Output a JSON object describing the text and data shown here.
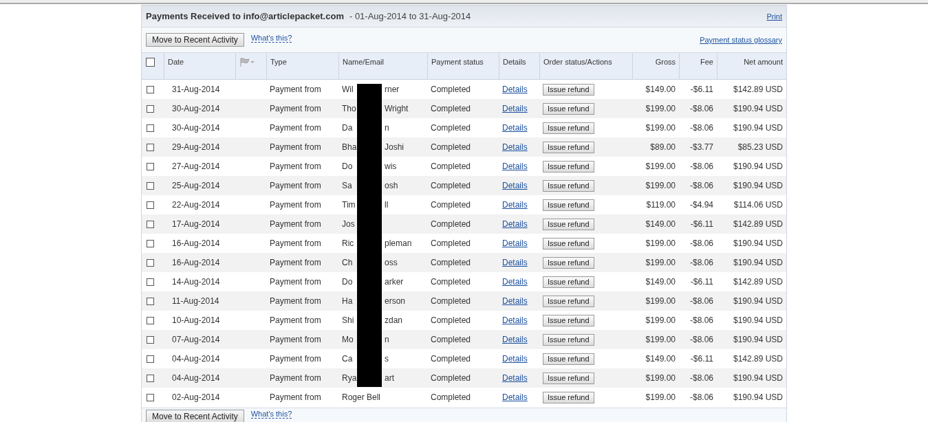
{
  "panel": {
    "title": "Payments Received to info@articlepacket.com",
    "date_range": "- 01-Aug-2014 to 31-Aug-2014",
    "print_link": "Print"
  },
  "toolbar": {
    "button": "Move to Recent Activity",
    "help_link": "What's this?",
    "glossary_link": "Payment status glossary"
  },
  "table": {
    "select_all": {
      "checked": false
    },
    "columns": [
      "Date",
      "Type",
      "Name/Email",
      "Payment status",
      "Details",
      "Order status/Actions",
      "Gross",
      "Fee",
      "Net amount"
    ],
    "rows": [
      {
        "checked": false,
        "date": "31-Aug-2014",
        "type": "Payment from",
        "name_start": "Wil",
        "name_end": "rner",
        "status": "Completed",
        "details": "Details",
        "action": "Issue refund",
        "gross": "$149.00",
        "fee": "-$6.11",
        "net": "$142.89 USD"
      },
      {
        "checked": false,
        "date": "30-Aug-2014",
        "type": "Payment from",
        "name_start": "Tho",
        "name_end": "Wright",
        "status": "Completed",
        "details": "Details",
        "action": "Issue refund",
        "gross": "$199.00",
        "fee": "-$8.06",
        "net": "$190.94 USD"
      },
      {
        "checked": false,
        "date": "30-Aug-2014",
        "type": "Payment from",
        "name_start": "Da",
        "name_end": "n",
        "status": "Completed",
        "details": "Details",
        "action": "Issue refund",
        "gross": "$199.00",
        "fee": "-$8.06",
        "net": "$190.94 USD"
      },
      {
        "checked": false,
        "date": "29-Aug-2014",
        "type": "Payment from",
        "name_start": "Bha",
        "name_end": "Joshi",
        "status": "Completed",
        "details": "Details",
        "action": "Issue refund",
        "gross": "$89.00",
        "fee": "-$3.77",
        "net": "$85.23 USD"
      },
      {
        "checked": false,
        "date": "27-Aug-2014",
        "type": "Payment from",
        "name_start": "Do",
        "name_end": "wis",
        "status": "Completed",
        "details": "Details",
        "action": "Issue refund",
        "gross": "$199.00",
        "fee": "-$8.06",
        "net": "$190.94 USD"
      },
      {
        "checked": false,
        "date": "25-Aug-2014",
        "type": "Payment from",
        "name_start": "Sa",
        "name_end": "osh",
        "status": "Completed",
        "details": "Details",
        "action": "Issue refund",
        "gross": "$199.00",
        "fee": "-$8.06",
        "net": "$190.94 USD"
      },
      {
        "checked": false,
        "date": "22-Aug-2014",
        "type": "Payment from",
        "name_start": "Tim",
        "name_end": "ll",
        "status": "Completed",
        "details": "Details",
        "action": "Issue refund",
        "gross": "$119.00",
        "fee": "-$4.94",
        "net": "$114.06 USD"
      },
      {
        "checked": false,
        "date": "17-Aug-2014",
        "type": "Payment from",
        "name_start": "Jos",
        "name_end": "",
        "status": "Completed",
        "details": "Details",
        "action": "Issue refund",
        "gross": "$149.00",
        "fee": "-$6.11",
        "net": "$142.89 USD"
      },
      {
        "checked": false,
        "date": "16-Aug-2014",
        "type": "Payment from",
        "name_start": "Ric",
        "name_end": "pleman",
        "status": "Completed",
        "details": "Details",
        "action": "Issue refund",
        "gross": "$199.00",
        "fee": "-$8.06",
        "net": "$190.94 USD"
      },
      {
        "checked": false,
        "date": "16-Aug-2014",
        "type": "Payment from",
        "name_start": "Ch",
        "name_end": "oss",
        "status": "Completed",
        "details": "Details",
        "action": "Issue refund",
        "gross": "$199.00",
        "fee": "-$8.06",
        "net": "$190.94 USD"
      },
      {
        "checked": false,
        "date": "14-Aug-2014",
        "type": "Payment from",
        "name_start": "Do",
        "name_end": "arker",
        "status": "Completed",
        "details": "Details",
        "action": "Issue refund",
        "gross": "$149.00",
        "fee": "-$6.11",
        "net": "$142.89 USD"
      },
      {
        "checked": false,
        "date": "11-Aug-2014",
        "type": "Payment from",
        "name_start": "Ha",
        "name_end": "erson",
        "status": "Completed",
        "details": "Details",
        "action": "Issue refund",
        "gross": "$199.00",
        "fee": "-$8.06",
        "net": "$190.94 USD"
      },
      {
        "checked": false,
        "date": "10-Aug-2014",
        "type": "Payment from",
        "name_start": "Shi",
        "name_end": "zdan",
        "status": "Completed",
        "details": "Details",
        "action": "Issue refund",
        "gross": "$199.00",
        "fee": "-$8.06",
        "net": "$190.94 USD"
      },
      {
        "checked": false,
        "date": "07-Aug-2014",
        "type": "Payment from",
        "name_start": "Mo",
        "name_end": "n",
        "status": "Completed",
        "details": "Details",
        "action": "Issue refund",
        "gross": "$199.00",
        "fee": "-$8.06",
        "net": "$190.94 USD"
      },
      {
        "checked": false,
        "date": "04-Aug-2014",
        "type": "Payment from",
        "name_start": "Ca",
        "name_end": "s",
        "status": "Completed",
        "details": "Details",
        "action": "Issue refund",
        "gross": "$149.00",
        "fee": "-$6.11",
        "net": "$142.89 USD"
      },
      {
        "checked": false,
        "date": "04-Aug-2014",
        "type": "Payment from",
        "name_start": "Rya",
        "name_end": "art",
        "status": "Completed",
        "details": "Details",
        "action": "Issue refund",
        "gross": "$199.00",
        "fee": "-$8.06",
        "net": "$190.94 USD"
      },
      {
        "checked": false,
        "date": "02-Aug-2014",
        "type": "Payment from",
        "name_start": "Roger Bell",
        "name_end": "",
        "status": "Completed",
        "details": "Details",
        "action": "Issue refund",
        "gross": "$199.00",
        "fee": "-$8.06",
        "net": "$190.94 USD"
      }
    ]
  },
  "bottom_toolbar": {
    "button": "Move to Recent Activity",
    "help_link": "What's this?"
  }
}
